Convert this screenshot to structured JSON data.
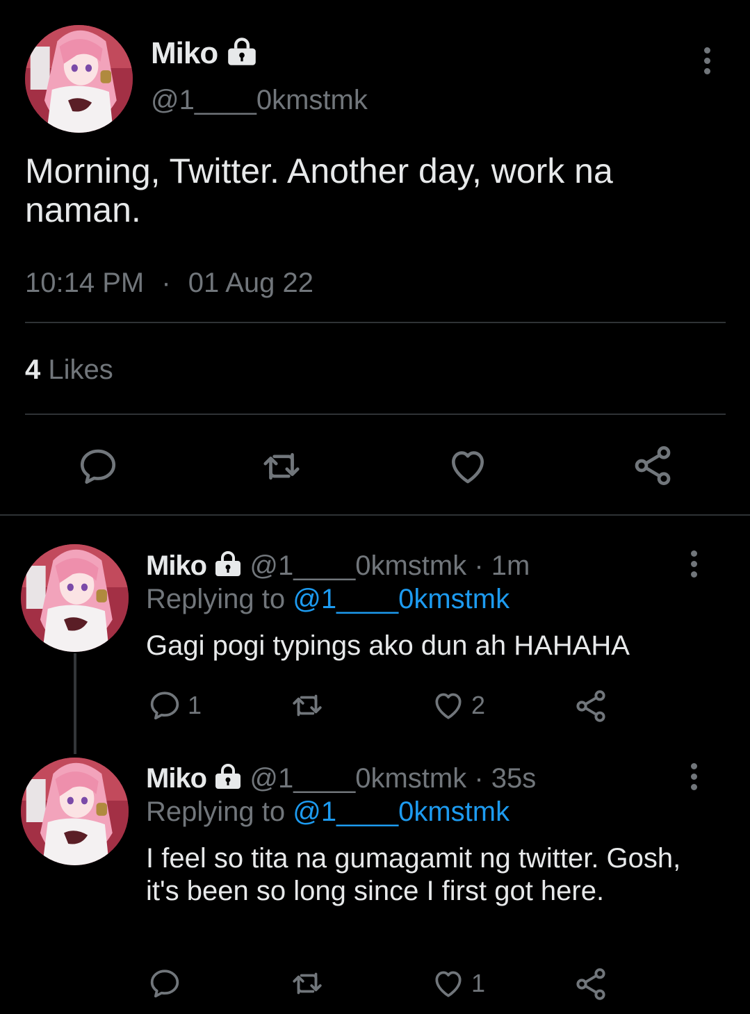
{
  "main_tweet": {
    "name": "Miko",
    "handle": "@1____0kmstmk",
    "text": "Morning, Twitter. Another day, work na naman.",
    "time": "10:14 PM",
    "separator": "·",
    "date": "01 Aug 22",
    "likes_count": "4",
    "likes_label": "Likes"
  },
  "replies": [
    {
      "name": "Miko",
      "handle": "@1____0kmstmk",
      "age": "· 1m",
      "replying_label": "Replying to",
      "replying_to": "@1____0kmstmk",
      "text": "Gagi pogi typings ako dun ah HAHAHA",
      "reply_count": "1",
      "retweet_count": "",
      "like_count": "2"
    },
    {
      "name": "Miko",
      "handle": "@1____0kmstmk",
      "age": "· 35s",
      "replying_label": "Replying to",
      "replying_to": "@1____0kmstmk",
      "text": "I feel so tita na gumagamit ng twitter. Gosh, it's been so long since I first got here.",
      "reply_count": "",
      "retweet_count": "",
      "like_count": "1"
    }
  ],
  "icons": {
    "reply": "comment-icon",
    "retweet": "retweet-icon",
    "like": "heart-icon",
    "share": "share-icon",
    "more": "more-vertical-icon",
    "protected": "lock-icon"
  },
  "colors": {
    "background": "#000000",
    "text": "#e7e9ea",
    "muted": "#71767b",
    "accent": "#1d9bf0",
    "divider": "#2f3336"
  }
}
